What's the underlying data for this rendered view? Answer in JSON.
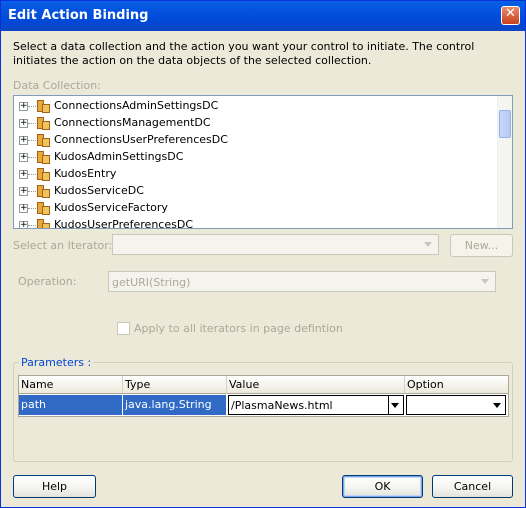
{
  "window": {
    "title": "Edit Action Binding"
  },
  "description": "Select a data collection and the action you want your control to initiate. The control initiates the action on the data objects of the selected collection.",
  "data_collection": {
    "label": "Data Collection:",
    "items": [
      {
        "label": "ConnectionsAdminSettingsDC"
      },
      {
        "label": "ConnectionsManagementDC"
      },
      {
        "label": "ConnectionsUserPreferencesDC"
      },
      {
        "label": "KudosAdminSettingsDC"
      },
      {
        "label": "KudosEntry"
      },
      {
        "label": "KudosServiceDC"
      },
      {
        "label": "KudosServiceFactory"
      },
      {
        "label": "KudosUserPreferencesDC"
      }
    ]
  },
  "iterator": {
    "label": "Select an Iterator:",
    "value": "",
    "new_button": "New..."
  },
  "operation": {
    "label": "Operation:",
    "value": "getURI(String)"
  },
  "apply_all": {
    "label": "Apply to all iterators in page defintion",
    "checked": false
  },
  "parameters": {
    "title": "Parameters :",
    "columns": [
      "Name",
      "Type",
      "Value",
      "Option"
    ],
    "rows": [
      {
        "name": "path",
        "type": "java.lang.String",
        "value": "/PlasmaNews.html",
        "option": ""
      }
    ]
  },
  "buttons": {
    "help": "Help",
    "ok": "OK",
    "cancel": "Cancel"
  },
  "colors": {
    "titlebar": "#0453e0",
    "selection": "#316ac5",
    "dialog_bg": "#ece9d8",
    "group_title": "#0046d5"
  }
}
